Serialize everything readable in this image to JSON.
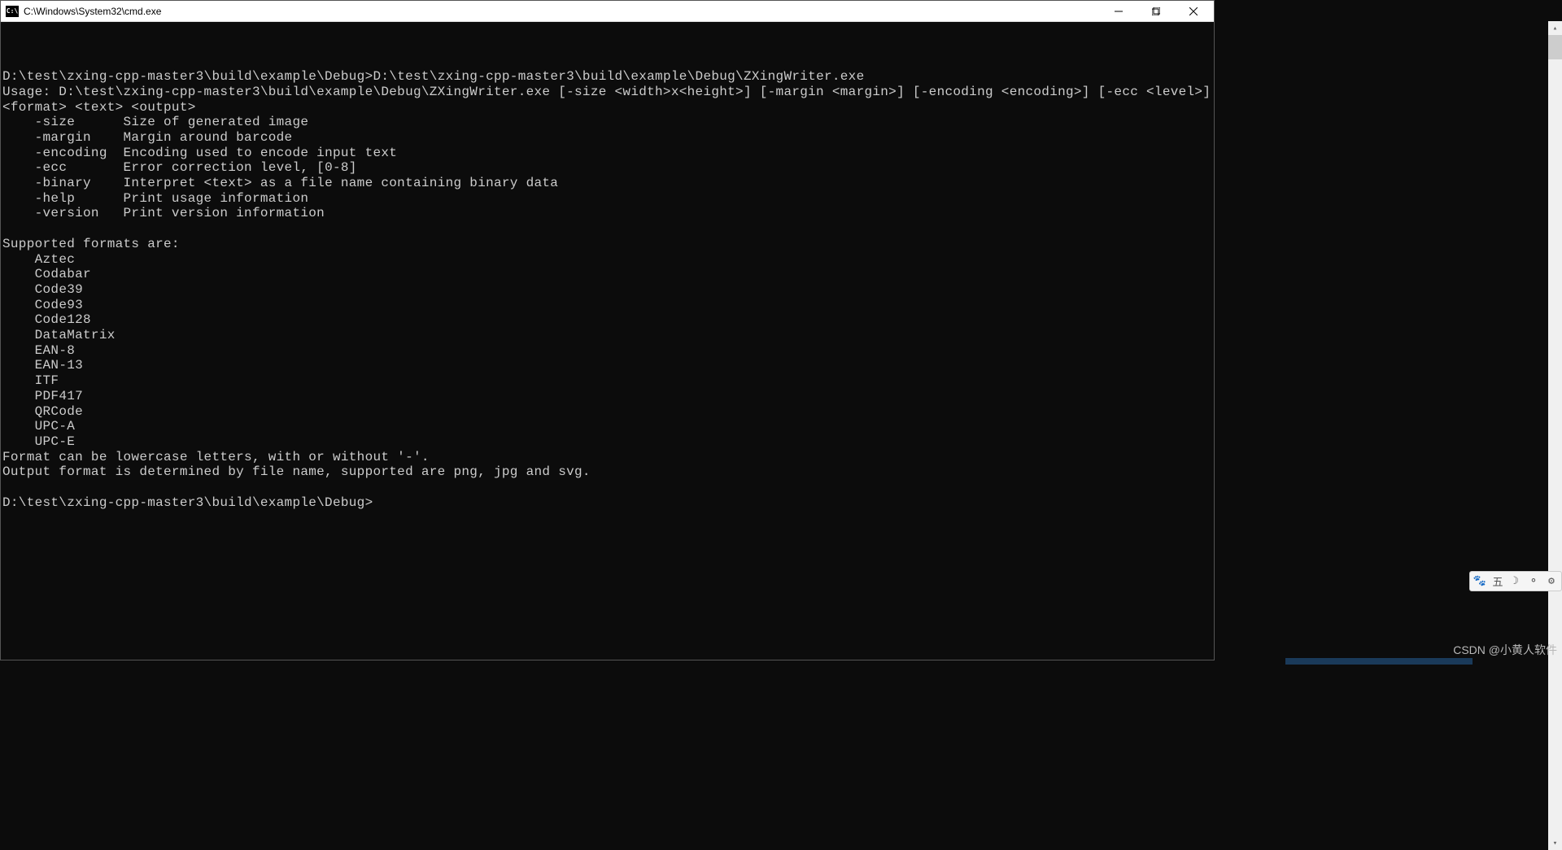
{
  "window": {
    "title": "C:\\Windows\\System32\\cmd.exe",
    "icon_text": "C:\\"
  },
  "console": {
    "blank_line": "",
    "prompt1": "D:\\test\\zxing-cpp-master3\\build\\example\\Debug>",
    "command1": "D:\\test\\zxing-cpp-master3\\build\\example\\Debug\\ZXingWriter.exe",
    "usage_line": "Usage: D:\\test\\zxing-cpp-master3\\build\\example\\Debug\\ZXingWriter.exe [-size <width>x<height>] [-margin <margin>] [-encoding <encoding>] [-ecc <level>] <format> <text> <output>",
    "opt_size": "    -size      Size of generated image",
    "opt_margin": "    -margin    Margin around barcode",
    "opt_encoding": "    -encoding  Encoding used to encode input text",
    "opt_ecc": "    -ecc       Error correction level, [0-8]",
    "opt_binary": "    -binary    Interpret <text> as a file name containing binary data",
    "opt_help": "    -help      Print usage information",
    "opt_version": "    -version   Print version information",
    "formats_header": "Supported formats are:",
    "formats": [
      "    Aztec",
      "    Codabar",
      "    Code39",
      "    Code93",
      "    Code128",
      "    DataMatrix",
      "    EAN-8",
      "    EAN-13",
      "    ITF",
      "    PDF417",
      "    QRCode",
      "    UPC-A",
      "    UPC-E"
    ],
    "format_note1": "Format can be lowercase letters, with or without '-'.",
    "format_note2": "Output format is determined by file name, supported are png, jpg and svg.",
    "prompt2": "D:\\test\\zxing-cpp-master3\\build\\example\\Debug>"
  },
  "tray": {
    "icon1": "🐾",
    "icon2": "五",
    "icon3": "☽",
    "icon4": "⚬",
    "icon5": "⚙"
  },
  "watermark": "CSDN @小黄人软件"
}
